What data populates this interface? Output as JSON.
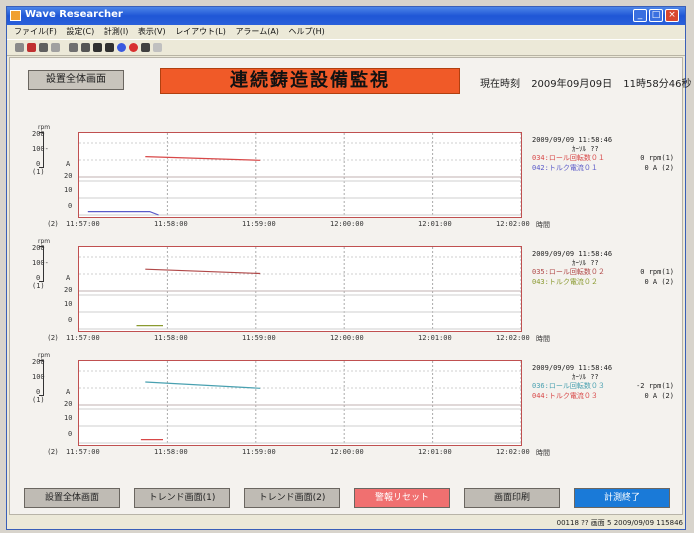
{
  "window": {
    "title": "Wave Researcher"
  },
  "menu": [
    "ファイル(F)",
    "設定(C)",
    "計測(I)",
    "表示(V)",
    "レイアウト(L)",
    "アラーム(A)",
    "ヘルプ(H)"
  ],
  "header": {
    "overview_button": "設置全体画面",
    "banner": "連続鋳造設備監視",
    "clock_label": "現在時刻",
    "date": "2009年09月09日",
    "time": "11時58分46秒"
  },
  "panels": [
    {
      "unit_top": "rpm",
      "scale_upper": [
        "200",
        "100-",
        "0",
        "(1)"
      ],
      "scale_lower": [
        "A",
        "20",
        "10",
        "0"
      ],
      "axis_tag": "(2)",
      "x_ticks": [
        "11:57:00",
        "11:58:00",
        "11:59:00",
        "12:00:00",
        "12:01:00",
        "12:02:00"
      ],
      "x_unit": "時間",
      "timestamp": "2009/09/09 11:58:46",
      "cursor_label": "ｶｰｿﾙ ??",
      "series": [
        {
          "name": "034:ロール回転数０１",
          "value": "0 rpm(1)",
          "color": "#d84848"
        },
        {
          "name": "042:トルク電流０１",
          "value": "0 A (2)",
          "color": "#5a5ac8"
        }
      ]
    },
    {
      "unit_top": "rpm",
      "scale_upper": [
        "200",
        "100-",
        "0",
        "(1)"
      ],
      "scale_lower": [
        "A",
        "20",
        "10",
        "0"
      ],
      "axis_tag": "(2)",
      "x_ticks": [
        "11:57:00",
        "11:58:00",
        "11:59:00",
        "12:00:00",
        "12:01:00",
        "12:02:00"
      ],
      "x_unit": "時間",
      "timestamp": "2009/09/09 11:58:46",
      "cursor_label": "ｶｰｿﾙ ??",
      "series": [
        {
          "name": "035:ロール回転数０２",
          "value": "0 rpm(1)",
          "color": "#b04848"
        },
        {
          "name": "043:トルク電流０２",
          "value": "0 A (2)",
          "color": "#8a9a30"
        }
      ]
    },
    {
      "unit_top": "rpm",
      "scale_upper": [
        "200",
        "100",
        "0",
        "(1)"
      ],
      "scale_lower": [
        "A",
        "20",
        "10",
        "0"
      ],
      "axis_tag": "(2)",
      "x_ticks": [
        "11:57:00",
        "11:58:00",
        "11:59:00",
        "12:00:00",
        "12:01:00",
        "12:02:00"
      ],
      "x_unit": "時間",
      "timestamp": "2009/09/09 11:58:46",
      "cursor_label": "ｶｰｿﾙ ??",
      "series": [
        {
          "name": "036:ロール回転数０３",
          "value": "-2 rpm(1)",
          "color": "#48a0b0"
        },
        {
          "name": "044:トルク電流０３",
          "value": "0 A (2)",
          "color": "#d84848"
        }
      ]
    }
  ],
  "buttons": {
    "overview": "設置全体画面",
    "trend1": "トレンド画面(1)",
    "trend2": "トレンド画面(2)",
    "alarm_reset": "警報リセット",
    "print": "画面印刷",
    "end": "計測終了"
  },
  "status": {
    "text": "00118 ?? 画面 5 2009/09/09 115846"
  },
  "chart_data": [
    {
      "type": "line",
      "x": [
        "11:57:00",
        "11:58:00",
        "11:59:00",
        "12:00:00",
        "12:01:00",
        "12:02:00"
      ],
      "series": [
        {
          "name": "034:ロール回転数０１",
          "points": [
            [
              0.75,
              120
            ],
            [
              2.05,
              98
            ]
          ]
        },
        {
          "name": "042:トルク電流０１",
          "points": [
            [
              0.1,
              2
            ],
            [
              0.8,
              2
            ],
            [
              0.9,
              0
            ]
          ]
        }
      ]
    },
    {
      "type": "line",
      "x": [
        "11:57:00",
        "11:58:00",
        "11:59:00",
        "12:00:00",
        "12:01:00",
        "12:02:00"
      ],
      "series": [
        {
          "name": "035:ロール回転数０２",
          "points": [
            [
              0.75,
              128
            ],
            [
              2.05,
              103
            ]
          ]
        },
        {
          "name": "043:トルク電流０２",
          "points": [
            [
              0.65,
              2
            ],
            [
              0.95,
              2
            ]
          ]
        }
      ]
    },
    {
      "type": "line",
      "x": [
        "11:57:00",
        "11:58:00",
        "11:59:00",
        "12:00:00",
        "12:01:00",
        "12:02:00"
      ],
      "series": [
        {
          "name": "036:ロール回転数０３",
          "points": [
            [
              0.75,
              135
            ],
            [
              2.05,
              98
            ]
          ]
        },
        {
          "name": "044:トルク電流０３",
          "points": [
            [
              0.7,
              2
            ],
            [
              0.95,
              2
            ]
          ]
        }
      ]
    }
  ]
}
